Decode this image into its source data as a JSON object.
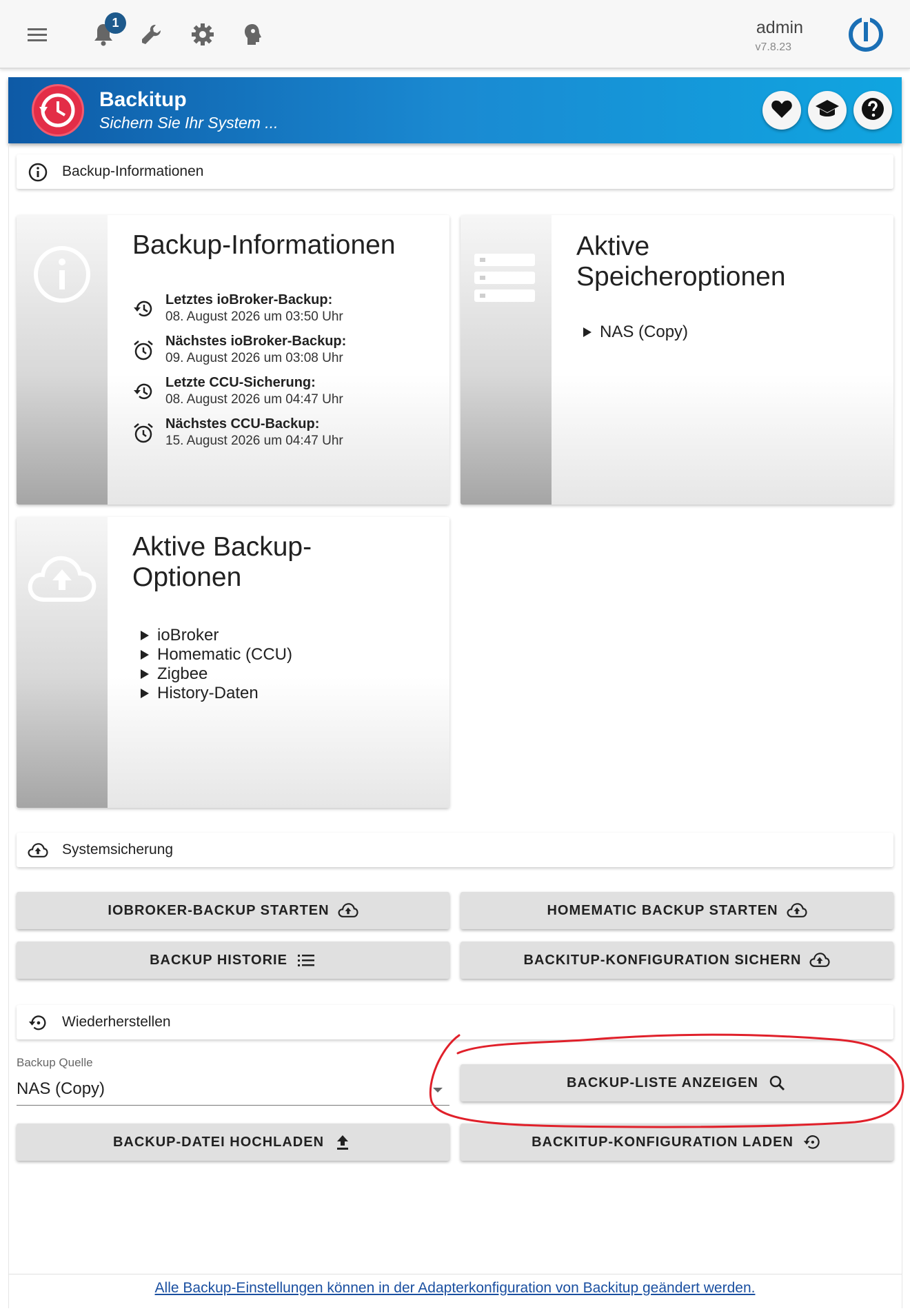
{
  "topbar": {
    "icons": [
      "menu-icon",
      "bell-icon",
      "wrench-icon",
      "gear-icon",
      "head-icon"
    ],
    "notification_count": "1",
    "user": "admin",
    "version": "v7.8.23",
    "logo": "iobroker-logo"
  },
  "header": {
    "title": "Backitup",
    "subtitle": "Sichern Sie Ihr System ...",
    "buttons": [
      "heart-icon",
      "graduation-cap-icon",
      "help-icon"
    ],
    "accent": "#1a8ad2",
    "logo_color": "#e32d47"
  },
  "sections": {
    "info": "Backup-Informationen",
    "system": "Systemsicherung",
    "restore": "Wiederherstellen"
  },
  "cards": {
    "info": {
      "title": "Backup-Informationen",
      "rows": [
        {
          "label": "Letztes ioBroker-Backup:",
          "value": "08. August 2026 um 03:50 Uhr",
          "icon": "history-icon"
        },
        {
          "label": "Nächstes ioBroker-Backup:",
          "value": "09. August 2026 um 03:08 Uhr",
          "icon": "alarm-clock-icon"
        },
        {
          "label": "Letzte CCU-Sicherung:",
          "value": "08. August 2026 um 04:47 Uhr",
          "icon": "history-icon"
        },
        {
          "label": "Nächstes CCU-Backup:",
          "value": "15. August 2026 um 04:47 Uhr",
          "icon": "alarm-clock-icon"
        }
      ]
    },
    "storage": {
      "title_line1": "Aktive",
      "title_line2": "Speicheroptionen",
      "items": [
        "NAS (Copy)"
      ]
    },
    "options": {
      "title_line1": "Aktive Backup-",
      "title_line2": "Optionen",
      "items": [
        "ioBroker",
        "Homematic (CCU)",
        "Zigbee",
        "History-Daten"
      ]
    }
  },
  "buttons": {
    "iobroker_start": "IOBROKER-BACKUP STARTEN",
    "homematic_start": "HOMEMATIC BACKUP STARTEN",
    "history": "BACKUP HISTORIE",
    "save_config": "BACKITUP-KONFIGURATION SICHERN",
    "show_list": "BACKUP-LISTE ANZEIGEN",
    "upload": "BACKUP-DATEI HOCHLADEN",
    "load_config": "BACKITUP-KONFIGURATION LADEN"
  },
  "restore": {
    "source_label": "Backup Quelle",
    "source_value": "NAS (Copy)"
  },
  "footer": {
    "link": "Alle Backup-Einstellungen können in der Adapterkonfiguration von Backitup geändert werden."
  },
  "annotation": {
    "color": "#e0202a"
  }
}
